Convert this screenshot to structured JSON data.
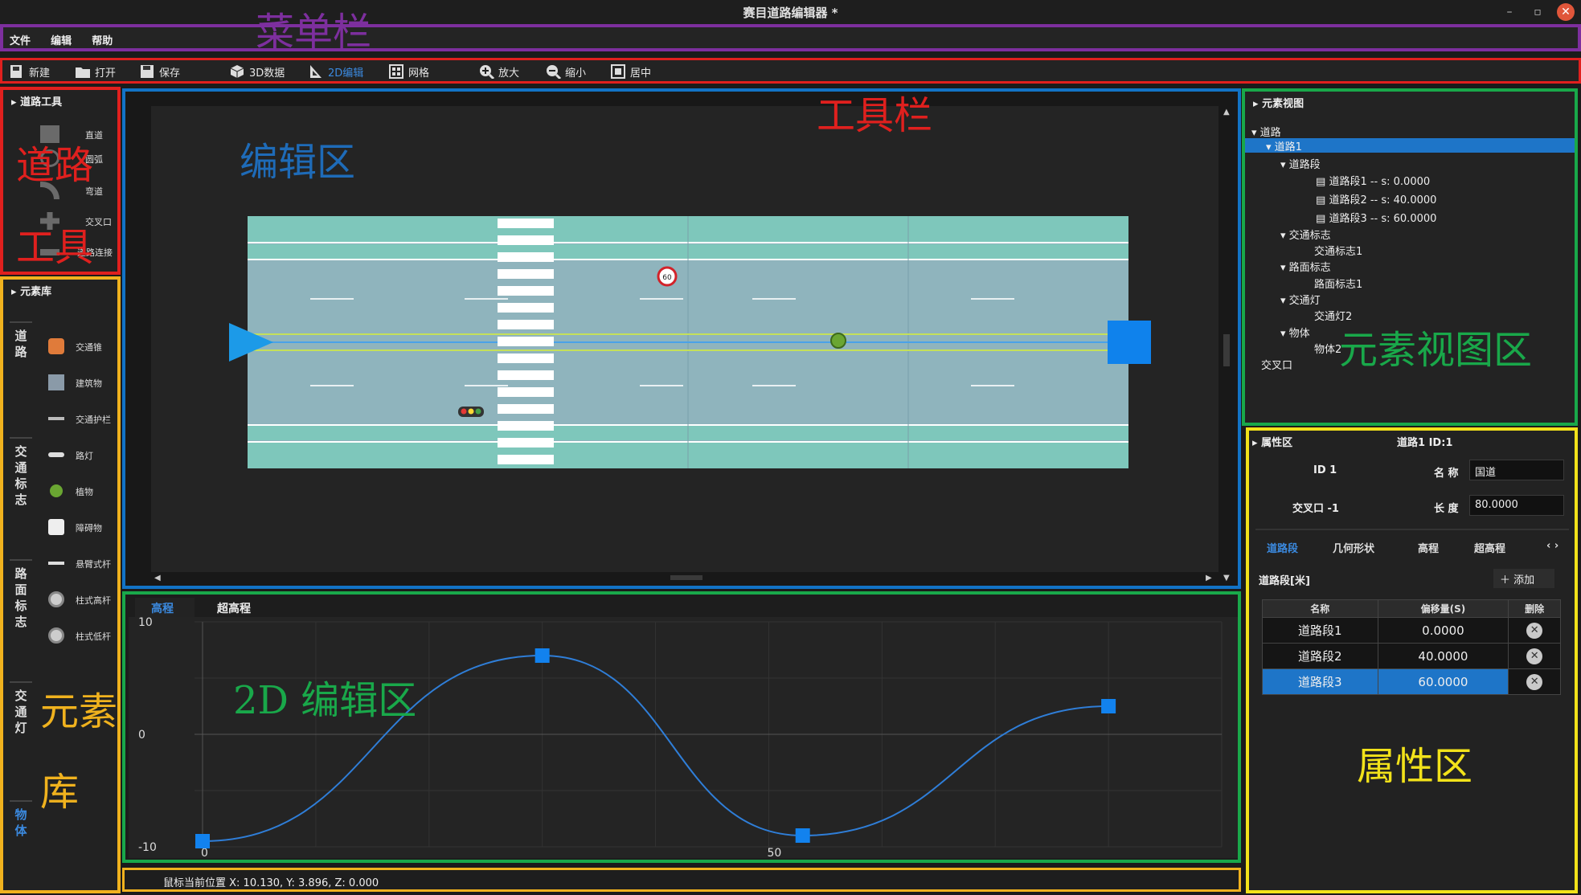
{
  "window": {
    "title": "赛目道路编辑器   *"
  },
  "menubar": {
    "items": [
      "文件",
      "编辑",
      "帮助"
    ]
  },
  "toolbar": {
    "new": "新建",
    "open": "打开",
    "save": "保存",
    "data3d": "3D数据",
    "edit2d": "2D编辑",
    "grid": "网格",
    "zoom_in": "放大",
    "zoom_out": "缩小",
    "center": "居中"
  },
  "road_tools": {
    "title": "道路工具",
    "items": [
      "直道",
      "圆弧",
      "弯道",
      "交叉口",
      "道路连接"
    ]
  },
  "element_library": {
    "title": "元素库",
    "categories": [
      "道路",
      "交通标志",
      "路面标志",
      "交通灯",
      "物体"
    ],
    "items": [
      "交通锥",
      "建筑物",
      "交通护栏",
      "路灯",
      "植物",
      "障碍物",
      "悬臂式杆",
      "柱式高杆",
      "柱式低杆"
    ]
  },
  "element_view": {
    "title": "元素视图",
    "tree": [
      "道路",
      "道路1",
      "道路段",
      "道路段1 -- s:  0.0000",
      "道路段2 -- s:  40.0000",
      "道路段3 -- s:  60.0000",
      "交通标志",
      "交通标志1",
      "路面标志",
      "路面标志1",
      "交通灯",
      "交通灯2",
      "物体",
      "物体2",
      "交叉口"
    ]
  },
  "property": {
    "title": "属性区",
    "header_value": "道路1 ID:1",
    "id_label": "ID  1",
    "name_label": "名  称",
    "name_value": "国道",
    "junction_label": "交叉口  -1",
    "length_label": "长  度",
    "length_value": "80.0000",
    "tabs": [
      "道路段",
      "几何形状",
      "高程",
      "超高程"
    ],
    "section_label": "道路段[米]",
    "add_button": "添加",
    "columns": [
      "名称",
      "偏移量(S)",
      "删除"
    ],
    "rows": [
      {
        "name": "道路段1",
        "offset": "0.0000"
      },
      {
        "name": "道路段2",
        "offset": "40.0000"
      },
      {
        "name": "道路段3",
        "offset": "60.0000"
      }
    ]
  },
  "edit2d": {
    "tabs": [
      "高程",
      "超高程"
    ],
    "chart_data": {
      "type": "line",
      "x": [
        0,
        30,
        53,
        80
      ],
      "y": [
        -9.5,
        7,
        -9,
        2.5
      ],
      "xlim": [
        0,
        90
      ],
      "ylim": [
        -10,
        10
      ],
      "y_ticks": [
        "10",
        "0",
        "-10"
      ],
      "x_ticks": [
        "0",
        "50"
      ],
      "grid": true
    }
  },
  "canvas_sign": "60",
  "status": {
    "text": "鼠标当前位置 X: 10.130, Y: 3.896, Z: 0.000"
  },
  "annotations": {
    "menubar": "菜单栏",
    "toolbar": "工具栏",
    "road_tools_1": "道路",
    "road_tools_2": "工具",
    "edit_area": "编辑区",
    "element_view": "元素视图区",
    "edit2d": "2D 编辑区",
    "property": "属性区",
    "elemlib_1": "元素",
    "elemlib_2": "库"
  },
  "colors": {
    "menubar_frame": "#7d2f9e",
    "toolbar_frame": "#e0201e",
    "editarea_frame": "#1273c6",
    "view_frame": "#19a84a",
    "property_frame": "#f2e21a",
    "library_frame": "#f0b21e",
    "selection": "#1e75c8"
  }
}
